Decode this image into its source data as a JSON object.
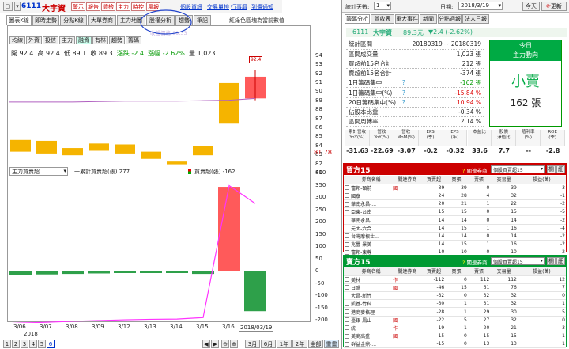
{
  "header": {
    "stock_code": "6111",
    "stock_name": "大宇資",
    "buttons": [
      "警示",
      "報告",
      "體檢",
      "主力",
      "時控",
      "風報"
    ],
    "links": [
      "個股資訊",
      "交易量排",
      "行事曆",
      "到價通知"
    ]
  },
  "left_tabs": [
    "圖表K線",
    "即時走勢",
    "分點K線",
    "大單券商",
    "主力地圖",
    "股權分析",
    "趨勢",
    "筆記"
  ],
  "notice": "紅綠色區塊為當前數值",
  "ma_buttons": [
    "均線",
    "外資",
    "投信",
    "主力",
    "融資",
    "有林",
    "趨勢",
    "籌碼"
  ],
  "ohlc": {
    "open_label": "開",
    "open": "92.4",
    "high_label": "高",
    "high": "92.4",
    "low_label": "低",
    "low": "89.1",
    "close_label": "收",
    "close": "89.3",
    "change_label": "漲跌",
    "change": "-2.4",
    "pct_label": "漲幅",
    "pct": "-2.62%",
    "vol_label": "量",
    "vol": "1,023"
  },
  "faint_label": "收盤價格 89.33",
  "price_flags": {
    "top": "92.4",
    "bottom": "81.6",
    "current": "81.78"
  },
  "price_axis": [
    "94",
    "93",
    "92",
    "91",
    "90",
    "89",
    "88",
    "87",
    "86",
    "85",
    "84",
    "83",
    "82",
    "81"
  ],
  "lower_chart": {
    "select_value": "主力買賣超",
    "legend_line": "一累計買賣超(張) 277",
    "legend_bar": "買賣超(張) -162",
    "axis": [
      "400",
      "350",
      "300",
      "250",
      "200",
      "150",
      "100",
      "50",
      "0",
      "-50",
      "-100",
      "-150",
      "-200"
    ]
  },
  "chart_data": {
    "type": "bar",
    "categories": [
      "3/06",
      "3/07",
      "3/08",
      "3/09",
      "3/12",
      "3/13",
      "3/14",
      "3/15",
      "3/16",
      "2018/03/19"
    ],
    "series": [
      {
        "name": "買賣超(張)",
        "values": [
          -14,
          -12,
          -10,
          -8,
          -6,
          -4,
          -2,
          -10,
          345,
          -162
        ]
      },
      {
        "name": "累計買賣超(張)",
        "values": [
          -210,
          -207,
          -203,
          -200,
          -197,
          -195,
          -194,
          -188,
          350,
          277
        ]
      }
    ],
    "ylim": [
      -200,
      400
    ]
  },
  "x_year": "2018",
  "bottom_nav": {
    "pages": [
      "1",
      "2",
      "3",
      "4",
      "5",
      "6"
    ],
    "ranges": [
      "3月",
      "6月",
      "1年",
      "2年",
      "全部",
      "重畫"
    ]
  },
  "topbar_right": {
    "days_label": "統計天數:",
    "days_value": "1",
    "date_label": "日期:",
    "date_value": "2018/3/19",
    "today": "今天",
    "update": "更新"
  },
  "right_tabs": [
    "籌碼分析",
    "營收表",
    "重大事件",
    "新聞",
    "分點週報",
    "法人日報"
  ],
  "info": {
    "code": "6111",
    "name": "大宇資",
    "price": "89.3元",
    "change": "▼2.4 (-2.62%)"
  },
  "stats": [
    {
      "label": "統計區間",
      "value": "20180319 ~ 20180319",
      "cls": ""
    },
    {
      "label": "區間成交量",
      "value": "1,023 張",
      "cls": ""
    },
    {
      "label": "買超前15名合計",
      "value": "212 張",
      "cls": ""
    },
    {
      "label": "賣超前15名合計",
      "value": "-374 張",
      "cls": ""
    },
    {
      "label": "1日籌碼集中",
      "value": "-162 張",
      "cls": "green"
    },
    {
      "label": "1日籌碼集中(%)",
      "value": "-15.84 %",
      "cls": "red"
    },
    {
      "label": "20日籌碼集中(%)",
      "value": "10.94 %",
      "cls": "red"
    },
    {
      "label": "佔股本比重",
      "value": "-0.34 %",
      "cls": ""
    },
    {
      "label": "區間周轉率",
      "value": "2.14 %",
      "cls": ""
    }
  ],
  "today_box": {
    "title": "今日",
    "subtitle": "主力動向",
    "action": "小賣",
    "amount": "162 張"
  },
  "fin": {
    "headers": [
      "累計營收\nYoY(%)",
      "營收\nYoY(%)",
      "營收\nMoM(%)",
      "EPS\n(季)",
      "EPS\n(年)",
      "本益比",
      "股價\n淨值比",
      "殖利率\n(%)",
      "ROE\n(季)"
    ],
    "values": [
      "-31.63",
      "-22.69",
      "-3.07",
      "-0.2",
      "-0.32",
      "33.6",
      "7.7",
      "--",
      "-2.8"
    ]
  },
  "buy_panel": {
    "title": "買方15",
    "filter_label": "關連券商:",
    "filter_value": "個股買賣超15",
    "btn1": "欄",
    "btn2": "細",
    "headers": [
      "券商名稱",
      "關連券商",
      "買賣超",
      "買張",
      "賣張",
      "交易量",
      "損益(萬)"
    ],
    "rows": [
      [
        "富邦-碩前",
        "國",
        "39",
        "39",
        "0",
        "39",
        "-3"
      ],
      [
        "國泰",
        "",
        "24",
        "28",
        "4",
        "32",
        "-1"
      ],
      [
        "華南永昌-...",
        "",
        "20",
        "21",
        "1",
        "22",
        "-2"
      ],
      [
        "亞東-台南",
        "",
        "15",
        "15",
        "0",
        "15",
        "-5"
      ],
      [
        "華南永昌-...",
        "",
        "14",
        "14",
        "0",
        "14",
        "-2"
      ],
      [
        "元大-六合",
        "",
        "14",
        "15",
        "1",
        "16",
        "-4"
      ],
      [
        "台灣摩根士...",
        "",
        "14",
        "14",
        "0",
        "14",
        "-2"
      ],
      [
        "兆豐-景美",
        "",
        "14",
        "15",
        "1",
        "16",
        "-2"
      ],
      [
        "富邦-東尊",
        "",
        "10",
        "10",
        "0",
        "10",
        "-2"
      ]
    ]
  },
  "sell_panel": {
    "title": "賣方15",
    "filter_label": "關連券商:",
    "filter_value": "個股買賣超15",
    "btn1": "欄",
    "btn2": "細",
    "headers": [
      "券商名稱",
      "關連券商",
      "買賣超",
      "買張",
      "賣張",
      "交易量",
      "損益(萬)"
    ],
    "rows": [
      [
        "美林",
        "作",
        "-112",
        "0",
        "112",
        "112",
        "12"
      ],
      [
        "日盛",
        "國",
        "-46",
        "15",
        "61",
        "76",
        "7"
      ],
      [
        "大昌-新竹",
        "",
        "-32",
        "0",
        "32",
        "32",
        "0"
      ],
      [
        "凱基-竹科",
        "",
        "-30",
        "1",
        "31",
        "32",
        "1"
      ],
      [
        "港商麥格理",
        "",
        "-28",
        "1",
        "29",
        "30",
        "5"
      ],
      [
        "臺銀-鳳山",
        "國",
        "-22",
        "5",
        "27",
        "32",
        "0"
      ],
      [
        "統一",
        "作",
        "-19",
        "1",
        "20",
        "21",
        "3"
      ],
      [
        "美商高盛",
        "國",
        "-15",
        "0",
        "15",
        "15",
        "1"
      ],
      [
        "群益金鼎-...",
        "",
        "-15",
        "0",
        "13",
        "13",
        "1"
      ]
    ]
  },
  "colors": {
    "red": "#ff5a5a",
    "green": "#2ea04a",
    "orange": "#f5b400",
    "magenta": "#ff33ff",
    "panel_red": "#cc0000",
    "panel_green": "#009933",
    "today_green": "#00aa44"
  }
}
